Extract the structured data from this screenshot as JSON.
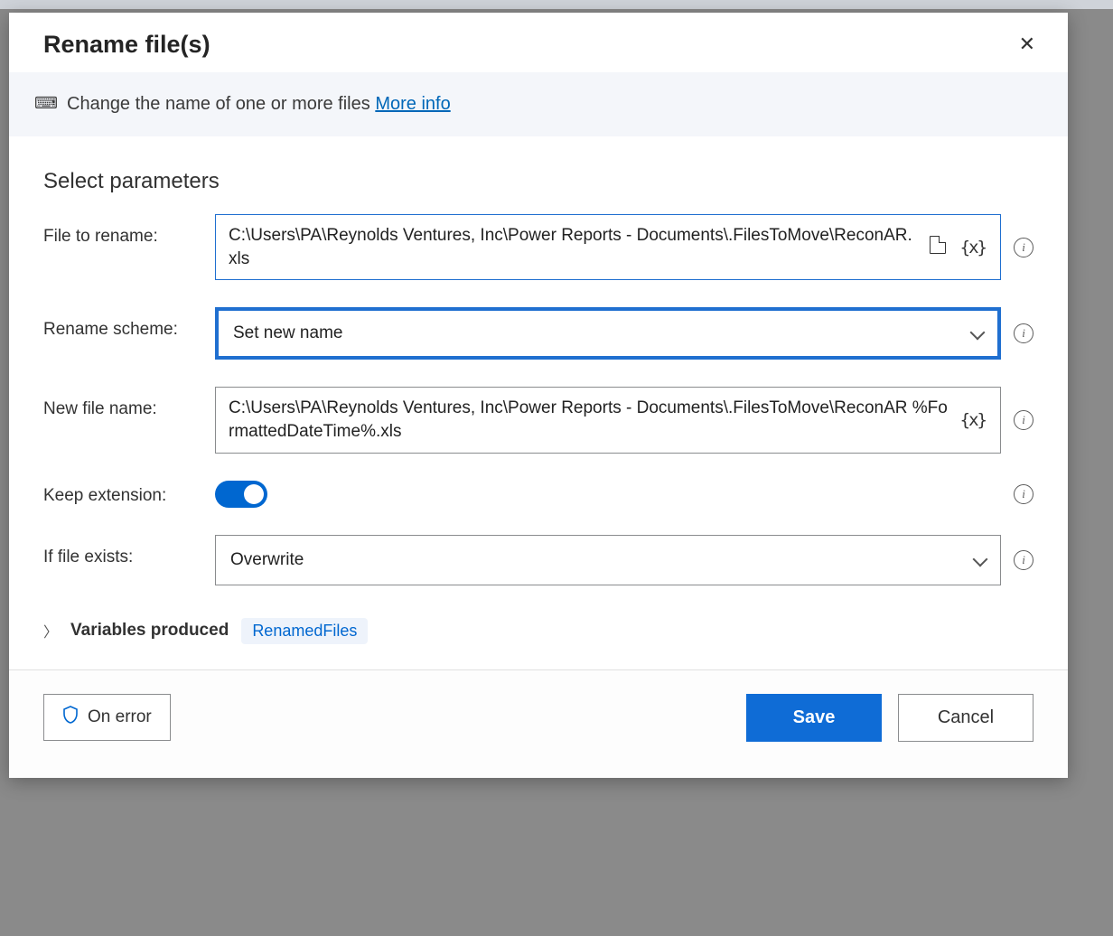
{
  "dialog": {
    "title": "Rename file(s)",
    "description": "Change the name of one or more files",
    "more_info_label": "More info"
  },
  "section": {
    "title": "Select parameters"
  },
  "fields": {
    "file_to_rename": {
      "label": "File to rename:",
      "value": "C:\\Users\\PA\\Reynolds Ventures, Inc\\Power Reports - Documents\\.FilesToMove\\ReconAR.xls"
    },
    "rename_scheme": {
      "label": "Rename scheme:",
      "value": "Set new name"
    },
    "new_file_name": {
      "label": "New file name:",
      "value": "C:\\Users\\PA\\Reynolds Ventures, Inc\\Power Reports - Documents\\.FilesToMove\\ReconAR %FormattedDateTime%.xls"
    },
    "keep_extension": {
      "label": "Keep extension:",
      "value": true
    },
    "if_file_exists": {
      "label": "If file exists:",
      "value": "Overwrite"
    }
  },
  "variables": {
    "label": "Variables produced",
    "chip": "RenamedFiles"
  },
  "footer": {
    "on_error": "On error",
    "save": "Save",
    "cancel": "Cancel"
  },
  "icons": {
    "info": "i",
    "var_insert": "{x}"
  }
}
